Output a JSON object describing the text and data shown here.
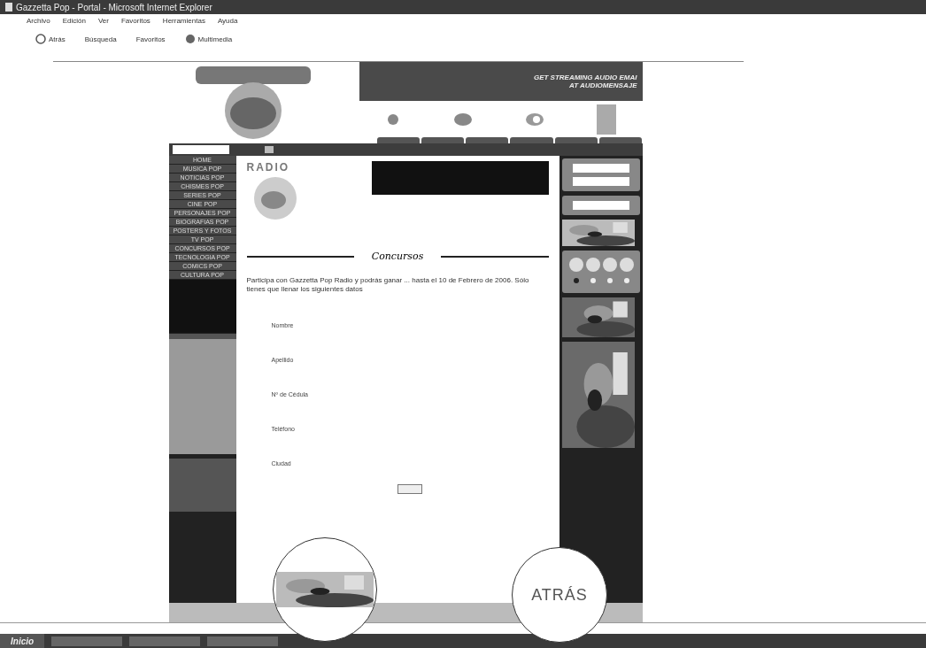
{
  "window": {
    "title": "Gazzetta Pop - Portal - Microsoft Internet Explorer"
  },
  "menu": [
    "Archivo",
    "Edición",
    "Ver",
    "Favoritos",
    "Herramientas",
    "Ayuda"
  ],
  "toolbar": [
    {
      "kind": "back",
      "label": "Atrás"
    },
    {
      "kind": "search",
      "label": "Búsqueda"
    },
    {
      "kind": "favorites",
      "label": "Favoritos"
    },
    {
      "kind": "media",
      "label": "Multimedia"
    }
  ],
  "banner": {
    "line_1": "GET STREAMING AUDIO EMAI",
    "line_2": "AT AUDIOMENSAJE"
  },
  "nav": [
    "HOME",
    "MUSICA POP",
    "NOTICIAS POP",
    "CHISMES POP",
    "SERIES POP",
    "CINE POP",
    "PERSONAJES POP",
    "BIOGRAFIAS POP",
    "POSTERS Y FOTOS",
    "TV POP",
    "CONCURSOS POP",
    "TECNOLOGIA POP",
    "COMICS POP",
    "CULTURA POP"
  ],
  "section": {
    "brand": "RADIO",
    "title": "Concursos",
    "intro": "Participa con Gazzetta Pop Radio y podrás ganar ... hasta el 10 de Febrero de 2006. Sólo tienes que llenar los siguientes datos"
  },
  "form": [
    {
      "label": "Nombre"
    },
    {
      "label": "Apellido"
    },
    {
      "label": "Nº de Cédula"
    },
    {
      "label": "Teléfono"
    },
    {
      "label": "Ciudad"
    }
  ],
  "back_link": "ATRÁS",
  "taskbar": {
    "start": "Inicio"
  }
}
